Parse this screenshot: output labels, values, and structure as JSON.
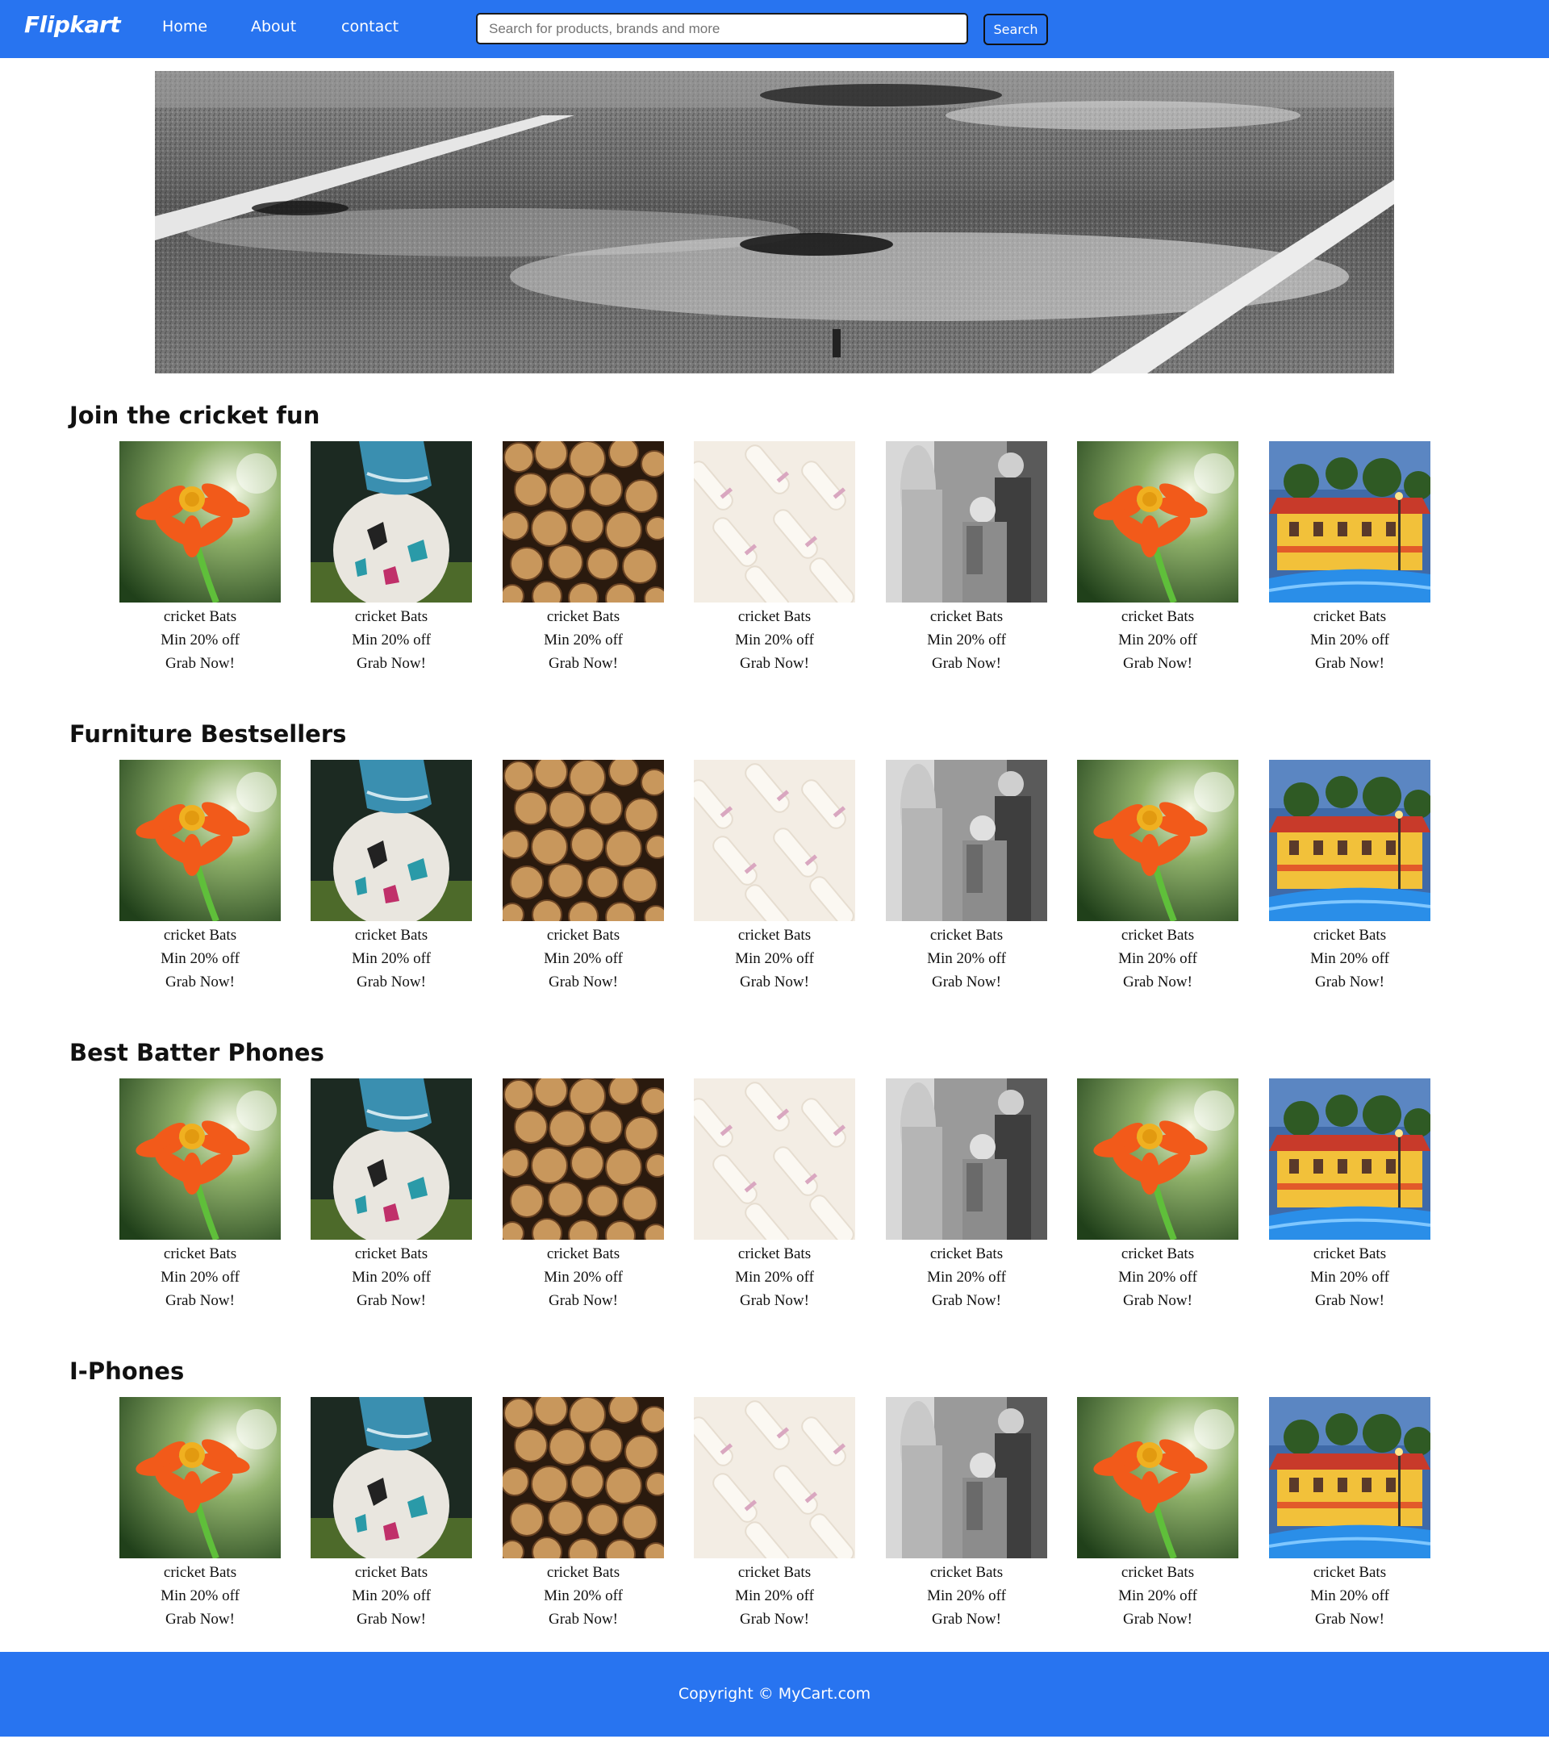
{
  "navbar": {
    "brand": "Flipkart",
    "links": [
      "Home",
      "About",
      "contact"
    ],
    "search_placeholder": "Search for products, brands and more",
    "search_value": "",
    "search_button": "Search"
  },
  "hero": {
    "image": "wet-road-crosswalk-banner"
  },
  "sections": [
    {
      "title": "Join the cricket fun",
      "cards": [
        {
          "image": "orange-flower",
          "name": "cricket Bats",
          "discount": "Min 20% off",
          "cta": "Grab Now!"
        },
        {
          "image": "football-boot",
          "name": "cricket Bats",
          "discount": "Min 20% off",
          "cta": "Grab Now!"
        },
        {
          "image": "wood-logs",
          "name": "cricket Bats",
          "discount": "Min 20% off",
          "cta": "Grab Now!"
        },
        {
          "image": "white-tampons",
          "name": "cricket Bats",
          "discount": "Min 20% off",
          "cta": "Grab Now!"
        },
        {
          "image": "bw-boys",
          "name": "cricket Bats",
          "discount": "Min 20% off",
          "cta": "Grab Now!"
        },
        {
          "image": "orange-flower",
          "name": "cricket Bats",
          "discount": "Min 20% off",
          "cta": "Grab Now!"
        },
        {
          "image": "colorful-building",
          "name": "cricket Bats",
          "discount": "Min 20% off",
          "cta": "Grab Now!"
        }
      ]
    },
    {
      "title": "Furniture Bestsellers",
      "cards": [
        {
          "image": "orange-flower",
          "name": "cricket Bats",
          "discount": "Min 20% off",
          "cta": "Grab Now!"
        },
        {
          "image": "football-boot",
          "name": "cricket Bats",
          "discount": "Min 20% off",
          "cta": "Grab Now!"
        },
        {
          "image": "wood-logs",
          "name": "cricket Bats",
          "discount": "Min 20% off",
          "cta": "Grab Now!"
        },
        {
          "image": "white-tampons",
          "name": "cricket Bats",
          "discount": "Min 20% off",
          "cta": "Grab Now!"
        },
        {
          "image": "bw-boys",
          "name": "cricket Bats",
          "discount": "Min 20% off",
          "cta": "Grab Now!"
        },
        {
          "image": "orange-flower",
          "name": "cricket Bats",
          "discount": "Min 20% off",
          "cta": "Grab Now!"
        },
        {
          "image": "colorful-building",
          "name": "cricket Bats",
          "discount": "Min 20% off",
          "cta": "Grab Now!"
        }
      ]
    },
    {
      "title": "Best Batter Phones",
      "cards": [
        {
          "image": "orange-flower",
          "name": "cricket Bats",
          "discount": "Min 20% off",
          "cta": "Grab Now!"
        },
        {
          "image": "football-boot",
          "name": "cricket Bats",
          "discount": "Min 20% off",
          "cta": "Grab Now!"
        },
        {
          "image": "wood-logs",
          "name": "cricket Bats",
          "discount": "Min 20% off",
          "cta": "Grab Now!"
        },
        {
          "image": "white-tampons",
          "name": "cricket Bats",
          "discount": "Min 20% off",
          "cta": "Grab Now!"
        },
        {
          "image": "bw-boys",
          "name": "cricket Bats",
          "discount": "Min 20% off",
          "cta": "Grab Now!"
        },
        {
          "image": "orange-flower",
          "name": "cricket Bats",
          "discount": "Min 20% off",
          "cta": "Grab Now!"
        },
        {
          "image": "colorful-building",
          "name": "cricket Bats",
          "discount": "Min 20% off",
          "cta": "Grab Now!"
        }
      ]
    },
    {
      "title": "I-Phones",
      "cards": [
        {
          "image": "orange-flower",
          "name": "cricket Bats",
          "discount": "Min 20% off",
          "cta": "Grab Now!"
        },
        {
          "image": "football-boot",
          "name": "cricket Bats",
          "discount": "Min 20% off",
          "cta": "Grab Now!"
        },
        {
          "image": "wood-logs",
          "name": "cricket Bats",
          "discount": "Min 20% off",
          "cta": "Grab Now!"
        },
        {
          "image": "white-tampons",
          "name": "cricket Bats",
          "discount": "Min 20% off",
          "cta": "Grab Now!"
        },
        {
          "image": "bw-boys",
          "name": "cricket Bats",
          "discount": "Min 20% off",
          "cta": "Grab Now!"
        },
        {
          "image": "orange-flower",
          "name": "cricket Bats",
          "discount": "Min 20% off",
          "cta": "Grab Now!"
        },
        {
          "image": "colorful-building",
          "name": "cricket Bats",
          "discount": "Min 20% off",
          "cta": "Grab Now!"
        }
      ]
    }
  ],
  "footer": {
    "copyright": "Copyright © MyCart.com"
  },
  "colors": {
    "brand_blue": "#2874f0",
    "text_dark": "#111111",
    "white": "#ffffff"
  }
}
